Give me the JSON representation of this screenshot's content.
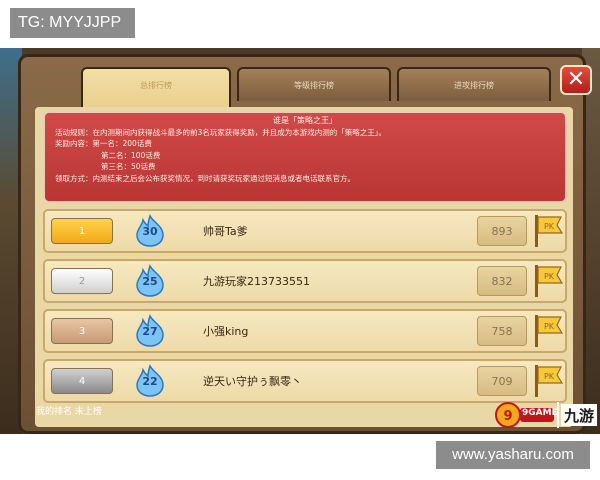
{
  "watermarks": {
    "top": "TG: MYYJJPP",
    "bottom": "www.yasharu.com"
  },
  "tabs": [
    {
      "label": "总排行榜",
      "active": true
    },
    {
      "label": "等级排行榜",
      "active": false
    },
    {
      "label": "进攻排行榜",
      "active": false
    }
  ],
  "close_label": "✕",
  "notice": {
    "title": "谁是「策略之王」",
    "rules": "活动规则：在内测期间内获得战斗最多的前3名玩家获得奖励，并且成为本游戏内测的「策略之王」。",
    "prize_intro": "奖励内容：第一名：200话费",
    "prize_2": "第二名：100话费",
    "prize_3": "第三名：50话费",
    "claim": "领取方式：内测结束之后会公布获奖情况，到时请获奖玩家通过短消息或者电话联系官方。"
  },
  "leaderboard": [
    {
      "rank": "1",
      "level": "30",
      "name": "帅哥Ta爹",
      "score": "893"
    },
    {
      "rank": "2",
      "level": "25",
      "name": "九游玩家213733551",
      "score": "832"
    },
    {
      "rank": "3",
      "level": "27",
      "name": "小强king",
      "score": "758"
    },
    {
      "rank": "4",
      "level": "22",
      "name": "逆天い守护ぅ飘零丶",
      "score": "709"
    }
  ],
  "my_rank": "我的排名 未上榜",
  "logo": {
    "game_text": "9GAME",
    "cn_text": "九游"
  },
  "colors": {
    "notice_bg": "#c23e3c",
    "rank_gold": "#f2a81c",
    "level_icon": "#5aa8e8",
    "flag": "#f2c23a"
  }
}
